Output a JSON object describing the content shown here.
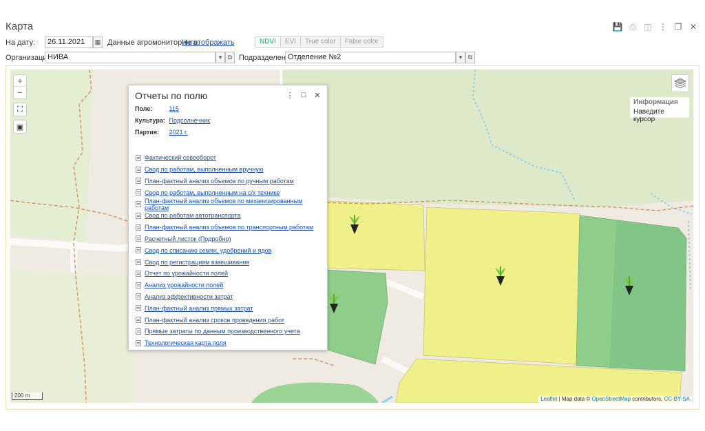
{
  "window": {
    "title": "Карта",
    "icons": [
      "save-icon",
      "print-icon",
      "preview-icon",
      "more-icon",
      "restore-icon",
      "close-icon"
    ]
  },
  "filters": {
    "date_label": "На дату:",
    "date_value": "26.11.2021",
    "agro_label": "Данные агромониторинга:",
    "agro_value": "Не отображать",
    "modes": [
      "NDVI",
      "EVI",
      "True color",
      "False color"
    ],
    "active_mode": "NDVI",
    "org_label": "Организация:",
    "org_value": "НИВА",
    "dept_label": "Подразделение:",
    "dept_value": "Отделение №2"
  },
  "map": {
    "info_title": "Информация",
    "info_text": "Наведите курсор",
    "scale": "200 m",
    "attribution": {
      "leaflet": "Leaflet",
      "mid": " | Map data © ",
      "osm": "OpenStreetMap",
      "contrib": " contributors, ",
      "license": "CC-BY-SA"
    },
    "colors": {
      "yellow_field": "#f0f08a",
      "green_field": "#8fce8a",
      "dark_green_field": "#7cbf84",
      "background": "#efeae2",
      "water": "#8fd2e8",
      "boundary": "#d4966a"
    }
  },
  "popup": {
    "title": "Отчеты по полю",
    "field_label": "Поле:",
    "field_value": "115",
    "crop_label": "Культура:",
    "crop_value": "Подсолнечник",
    "batch_label": "Партия:",
    "batch_value": "2021 г.",
    "reports": [
      "Фактический севооборот",
      "Свод по работам, выполненным вручную",
      "План-фактный анализ объемов по ручным работам",
      "Свод по работам, выполненным на с/х технике",
      "План-фактный анализ объемов по механизированным работам",
      "Свод по работам автотранспорта",
      "План-фактный анализ объемов по транспортным работам",
      "Расчетный листок (Подробно)",
      "Свод по списанию семян, удобрений и ядов",
      "Свод по регистрациям взвешивания",
      "Отчет по урожайности полей",
      "Анализ урожайности полей",
      "Анализ эффективности затрат",
      "План-фактный анализ прямых затрат",
      "План-фактный анализ сроков проведения работ",
      "Прямые затраты по данным производственного учета",
      "Технологическая карта поля"
    ]
  }
}
